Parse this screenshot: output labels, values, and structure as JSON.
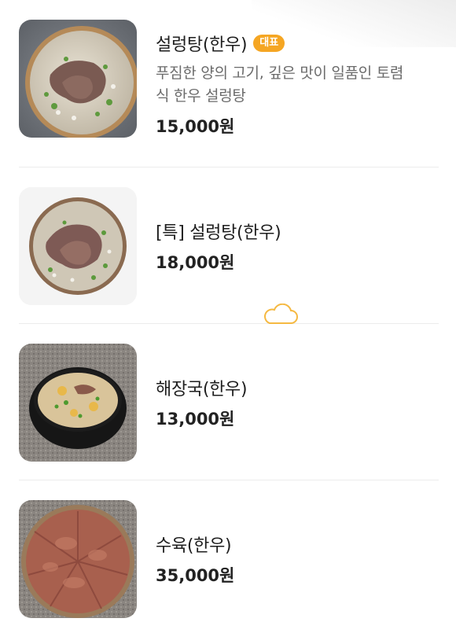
{
  "menu": {
    "items": [
      {
        "name": "설렁탕(한우)",
        "badge": "대표",
        "desc_line1": "푸짐한 양의 고기, 깊은 맛이 일품인 토렴",
        "desc_line2": "식 한우 설렁탕",
        "price": "15,000원",
        "image": "seolleongtang-photo"
      },
      {
        "name": "[특] 설렁탕(한우)",
        "price": "18,000원",
        "image": "special-seolleongtang-photo"
      },
      {
        "name": "해장국(한우)",
        "price": "13,000원",
        "image": "haejangguk-photo"
      },
      {
        "name": "수육(한우)",
        "price": "35,000원",
        "image": "suyuk-photo"
      }
    ]
  },
  "colors": {
    "badge": "#f5a623",
    "cloud_icon": "#f5b942",
    "divider": "#ececec"
  },
  "icons": {
    "floating": "cloud-icon"
  }
}
